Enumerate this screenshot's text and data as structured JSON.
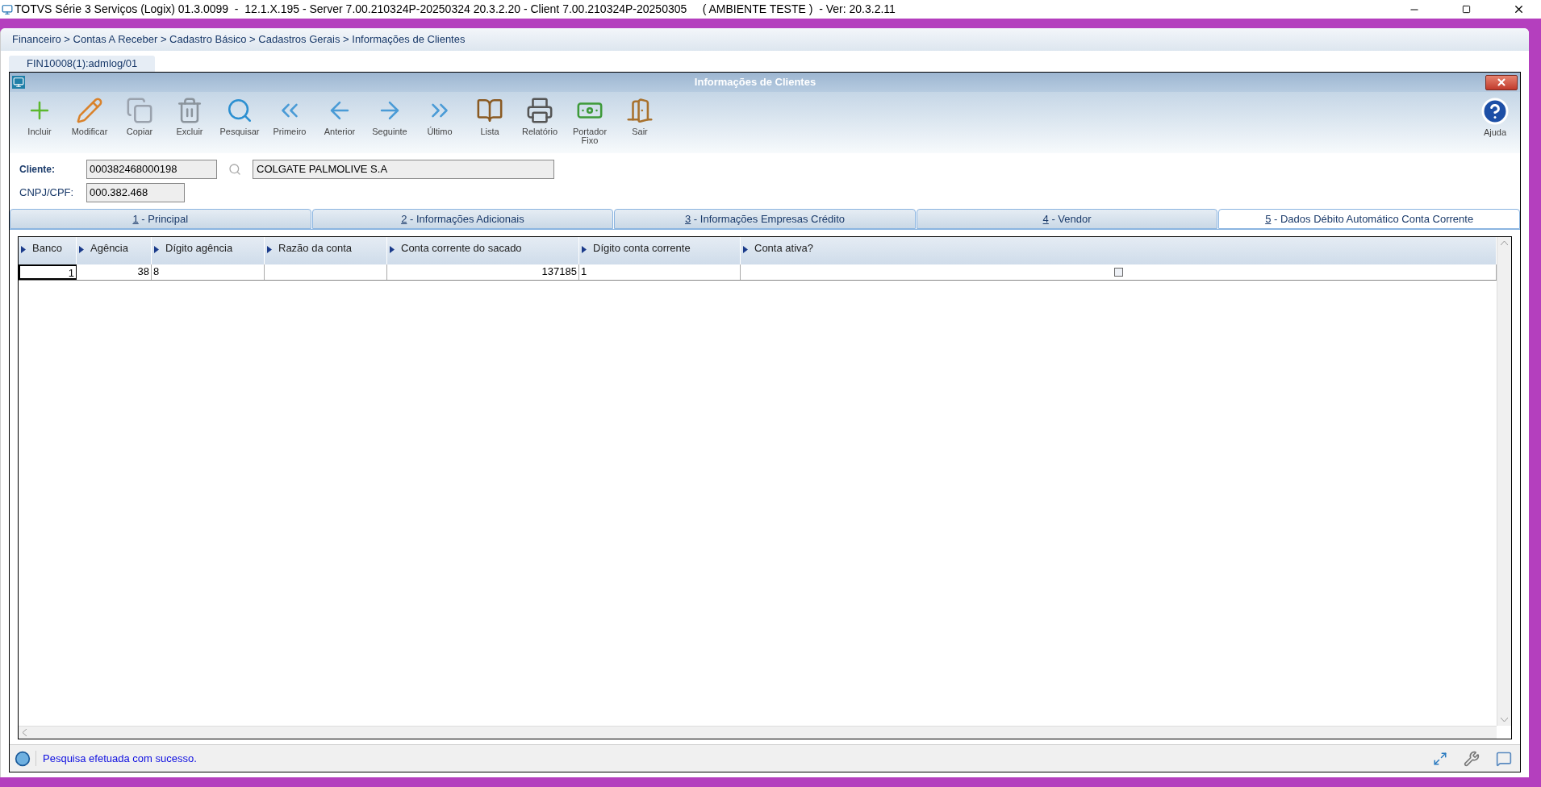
{
  "window": {
    "title": "TOTVS Série 3 Serviços (Logix) 01.3.0099  -  12.1.X.195 - Server 7.00.210324P-20250324 20.3.2.20 - Client 7.00.210324P-20250305     ( AMBIENTE TESTE )  - Ver: 20.3.2.11"
  },
  "breadcrumb": "Financeiro > Contas A Receber > Cadastro Básico > Cadastros Gerais > Informações de Clientes",
  "program_tab": "FIN10008(1):admlog/01",
  "form": {
    "title": "Informações de Clientes",
    "toolbar": [
      {
        "kind": "add",
        "label": "Incluir"
      },
      {
        "kind": "edit",
        "label": "Modificar"
      },
      {
        "kind": "copy",
        "label": "Copiar"
      },
      {
        "kind": "delete",
        "label": "Excluir"
      },
      {
        "kind": "search",
        "label": "Pesquisar"
      },
      {
        "kind": "first",
        "label": "Primeiro"
      },
      {
        "kind": "prev",
        "label": "Anterior"
      },
      {
        "kind": "next",
        "label": "Seguinte"
      },
      {
        "kind": "last",
        "label": "Último"
      },
      {
        "kind": "list",
        "label": "Lista"
      },
      {
        "kind": "report",
        "label": "Relatório"
      },
      {
        "kind": "money",
        "label": "Portador Fixo"
      },
      {
        "kind": "exit",
        "label": "Sair"
      }
    ],
    "help": {
      "label": "Ajuda"
    },
    "cliente": {
      "label": "Cliente:",
      "code": "000382468000198",
      "name": "COLGATE PALMOLIVE S.A"
    },
    "cnpj": {
      "label": "CNPJ/CPF:",
      "value": "000.382.468"
    },
    "tabs": [
      {
        "key": "1",
        "label": "- Principal",
        "selected": false
      },
      {
        "key": "2",
        "label": "- Informações Adicionais",
        "selected": false
      },
      {
        "key": "3",
        "label": "- Informações Empresas Crédito",
        "selected": false
      },
      {
        "key": "4",
        "label": "- Vendor",
        "selected": false
      },
      {
        "key": "5",
        "label": "- Dados Débito Automático Conta Corrente",
        "selected": true
      }
    ],
    "table": {
      "columns": [
        {
          "label": "Banco",
          "kind": "number"
        },
        {
          "label": "Agência",
          "kind": "number"
        },
        {
          "label": "Dígito agência",
          "kind": "text"
        },
        {
          "label": "Razão da conta",
          "kind": "text"
        },
        {
          "label": "Conta corrente do sacado",
          "kind": "number"
        },
        {
          "label": "Dígito conta corrente",
          "kind": "text"
        },
        {
          "label": "Conta ativa?",
          "kind": "flag"
        }
      ],
      "rows": [
        [
          {
            "kind": "text",
            "text": "1"
          },
          {
            "kind": "text",
            "text": "38"
          },
          {
            "kind": "text",
            "text": "8"
          },
          {
            "kind": "blank"
          },
          {
            "kind": "text",
            "text": "137185"
          },
          {
            "kind": "text",
            "text": "1"
          },
          {
            "kind": "checkbox",
            "checked": false
          }
        ]
      ]
    },
    "status": "Pesquisa efetuada com sucesso."
  }
}
